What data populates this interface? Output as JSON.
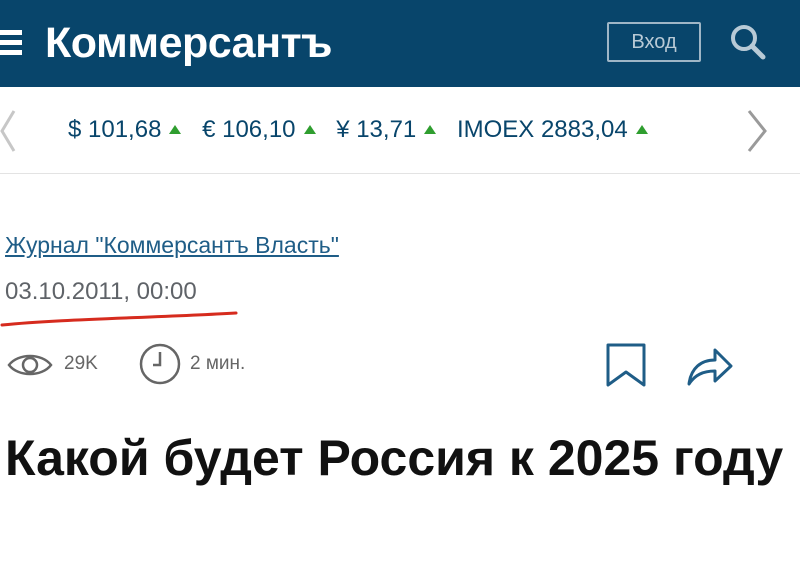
{
  "header": {
    "logo": "Коммерсантъ",
    "login_label": "Вход",
    "menu_icon": "hamburger-icon",
    "search_icon": "search-icon",
    "background": "#08456b"
  },
  "ticker": {
    "rates": [
      {
        "label": "$ 101,68",
        "trend": "up"
      },
      {
        "label": "€ 106,10",
        "trend": "up"
      },
      {
        "label": "¥ 13,71",
        "trend": "up"
      },
      {
        "label": "IMOEX 2883,04",
        "trend": "up"
      }
    ],
    "trend_color": "#2f9e2f"
  },
  "article": {
    "journal": "Журнал \"Коммерсантъ Власть\"",
    "date": "03.10.2011, 00:00",
    "views": "29K",
    "read_time": "2 мин.",
    "headline": "Какой будет Россия к 2025 году",
    "underline_color": "#d62b1e"
  }
}
